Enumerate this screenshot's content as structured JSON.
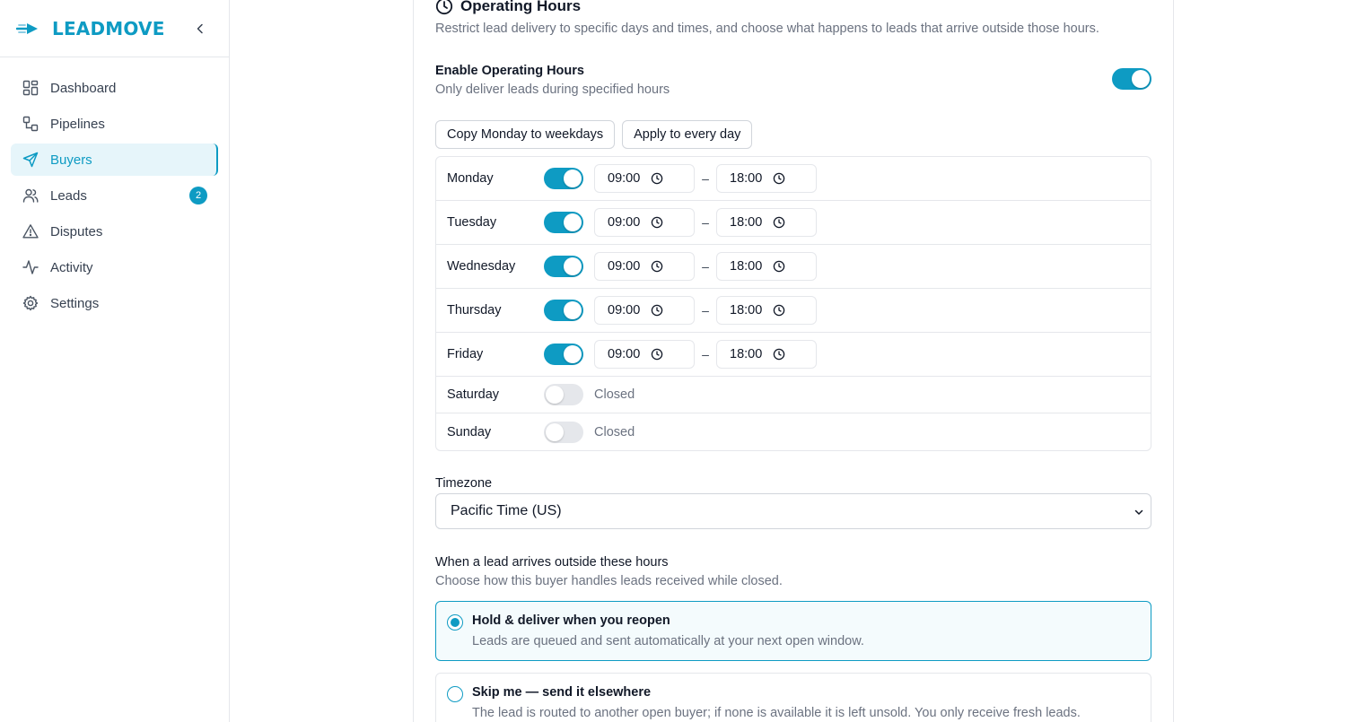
{
  "brand": {
    "name": "LEADMOVE",
    "accent": "#0e9bc3"
  },
  "sidebar": {
    "items": [
      {
        "label": "Dashboard",
        "icon": "dashboard-grid-icon"
      },
      {
        "label": "Pipelines",
        "icon": "pipelines-icon"
      },
      {
        "label": "Buyers",
        "icon": "send-icon",
        "active": true
      },
      {
        "label": "Leads",
        "icon": "users-icon",
        "badge": "2"
      },
      {
        "label": "Disputes",
        "icon": "alert-triangle-icon"
      },
      {
        "label": "Activity",
        "icon": "activity-icon"
      },
      {
        "label": "Settings",
        "icon": "gear-icon"
      }
    ]
  },
  "section": {
    "title": "Operating Hours",
    "description": "Restrict lead delivery to specific days and times, and choose what happens to leads that arrive outside those hours."
  },
  "enable": {
    "label": "Enable Operating Hours",
    "sublabel": "Only deliver leads during specified hours",
    "on": true
  },
  "actions": {
    "copy_monday": "Copy Monday to weekdays",
    "apply_every_day": "Apply to every day"
  },
  "days": [
    {
      "name": "Monday",
      "open": true,
      "start": "09:00",
      "end": "18:00"
    },
    {
      "name": "Tuesday",
      "open": true,
      "start": "09:00",
      "end": "18:00"
    },
    {
      "name": "Wednesday",
      "open": true,
      "start": "09:00",
      "end": "18:00"
    },
    {
      "name": "Thursday",
      "open": true,
      "start": "09:00",
      "end": "18:00"
    },
    {
      "name": "Friday",
      "open": true,
      "start": "09:00",
      "end": "18:00"
    },
    {
      "name": "Saturday",
      "open": false,
      "closed_label": "Closed"
    },
    {
      "name": "Sunday",
      "open": false,
      "closed_label": "Closed"
    }
  ],
  "range_separator": "–",
  "timezone": {
    "label": "Timezone",
    "value": "Pacific Time (US)"
  },
  "outside_hours": {
    "label": "When a lead arrives outside these hours",
    "sublabel": "Choose how this buyer handles leads received while closed.",
    "options": [
      {
        "title": "Hold & deliver when you reopen",
        "description": "Leads are queued and sent automatically at your next open window.",
        "selected": true
      },
      {
        "title": "Skip me — send it elsewhere",
        "description": "The lead is routed to another open buyer; if none is available it is left unsold. You only receive fresh leads.",
        "selected": false
      }
    ]
  }
}
